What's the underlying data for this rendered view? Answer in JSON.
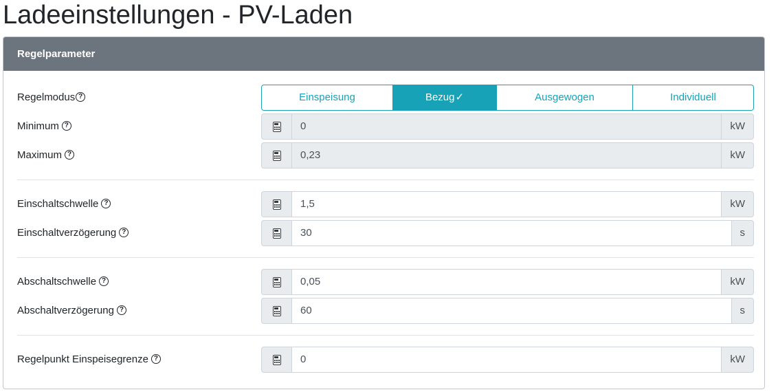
{
  "page_title": "Ladeeinstellungen - PV-Laden",
  "card": {
    "header": "Regelparameter",
    "help_glyph": "?",
    "icon": "calculator-icon",
    "regelmodus": {
      "label": "Regelmodus",
      "options": [
        "Einspeisung",
        "Bezug",
        "Ausgewogen",
        "Individuell"
      ],
      "selected": "Bezug",
      "check_glyph": "✓"
    },
    "minimum": {
      "label": "Minimum",
      "value": "0",
      "unit": "kW"
    },
    "maximum": {
      "label": "Maximum",
      "value": "0,23",
      "unit": "kW"
    },
    "einschaltschwelle": {
      "label": "Einschaltschwelle",
      "value": "1,5",
      "unit": "kW"
    },
    "einschaltverzoegerung": {
      "label": "Einschaltverzögerung",
      "value": "30",
      "unit": "s"
    },
    "abschaltschwelle": {
      "label": "Abschaltschwelle",
      "value": "0,05",
      "unit": "kW"
    },
    "abschaltverzoegerung": {
      "label": "Abschaltverzögerung",
      "value": "60",
      "unit": "s"
    },
    "regelpunkt": {
      "label": "Regelpunkt Einspeisegrenze",
      "value": "0",
      "unit": "kW"
    }
  },
  "colors": {
    "accent": "#17a2b8",
    "header_bg": "#6c757d",
    "addon_bg": "#e9ecef"
  }
}
